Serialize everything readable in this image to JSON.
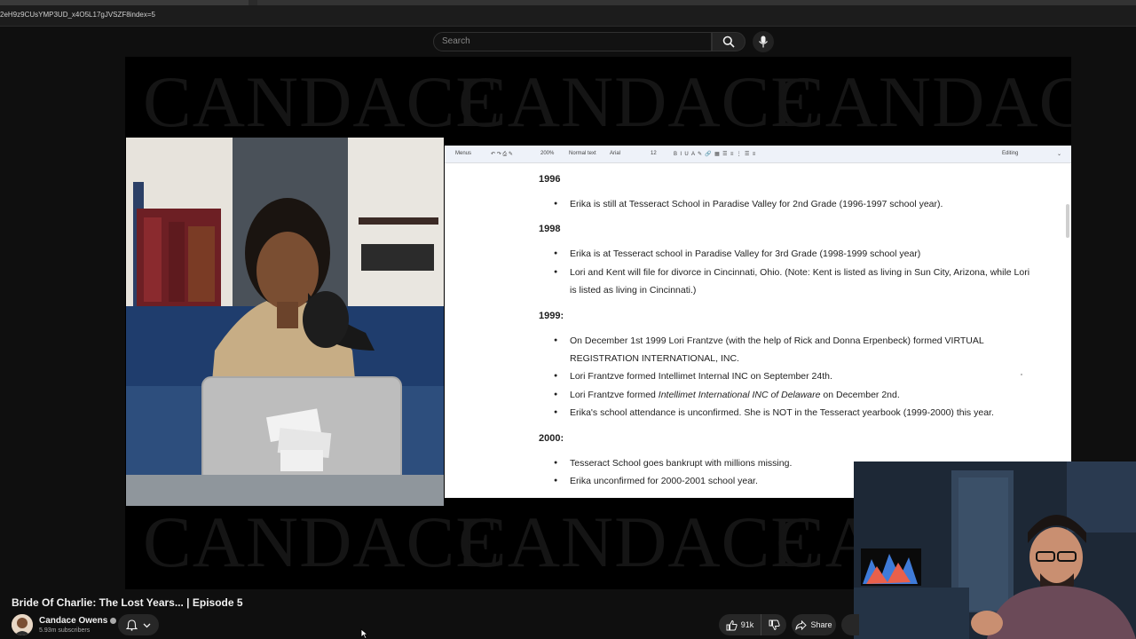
{
  "browser": {
    "url": "2eH9z9CUsYMP3UD_x4O5L17gJVSZF8index=5"
  },
  "masthead": {
    "search_placeholder": "Search",
    "search_icon": "search-icon",
    "mic_icon": "microphone-icon"
  },
  "player": {
    "watermark_text": "CANDACE",
    "doc_toolbar": {
      "menus": "Menus",
      "zoom": "200%",
      "style": "Normal text",
      "font": "Arial",
      "font_size": "12",
      "mode": "Editing"
    },
    "doc": {
      "sections": [
        {
          "year": "1996",
          "items": [
            {
              "text": "Erika is still at Tesseract School in Paradise Valley for 2nd Grade (1996-1997 school year)."
            }
          ]
        },
        {
          "year": "1998",
          "items": [
            {
              "text": "Erika is at Tesseract school in Paradise Valley for 3rd Grade (1998-1999 school year)"
            },
            {
              "text": "Lori and Kent will file for divorce in Cincinnati, Ohio. (Note: Kent is listed as living in Sun City, Arizona, while Lori is listed as living in Cincinnati.)"
            }
          ]
        },
        {
          "year": "1999:",
          "items": [
            {
              "text": "On December 1st 1999 Lori Frantzve (with the help of Rick and Donna Erpenbeck) formed VIRTUAL REGISTRATION INTERNATIONAL, INC."
            },
            {
              "text": "Lori Frantzve formed Intellimet Internal INC on September 24th."
            },
            {
              "before": "Lori Frantzve formed ",
              "italic": "Intellimet International INC of Delaware",
              "after": " on December 2nd."
            },
            {
              "text": "Erika's school attendance is unconfirmed. She is NOT in the Tesseract yearbook (1999-2000) this year."
            }
          ]
        },
        {
          "year": "2000:",
          "items": [
            {
              "text": "Tesseract School goes bankrupt with millions missing."
            },
            {
              "text": "Erika unconfirmed for 2000-2001 school year."
            }
          ]
        }
      ]
    }
  },
  "video": {
    "title": "Bride Of Charlie: The Lost Years... | Episode 5",
    "channel": "Candace Owens",
    "subscribers": "5.93m subscribers",
    "likes": "91k",
    "share_label": "Share"
  },
  "colors": {
    "page_bg": "#0f0f0f",
    "button_bg": "#272727",
    "doc_bg": "#ffffff",
    "watermark": "#151515"
  }
}
